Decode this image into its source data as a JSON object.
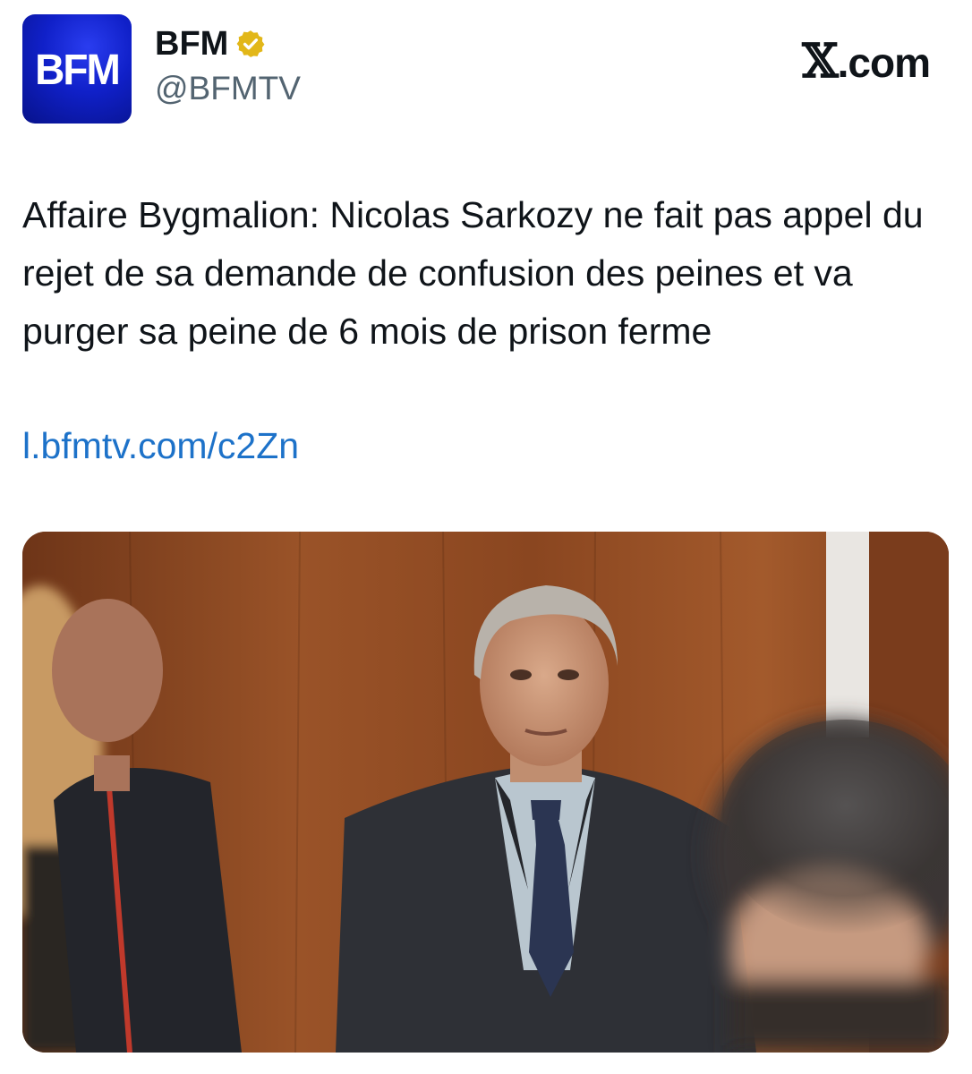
{
  "author": {
    "avatar_text": "BFM",
    "display_name": "BFM",
    "handle": "@BFMTV",
    "verified_icon": "gold-verified-badge-icon"
  },
  "brand": {
    "logo_icon": "x-logo-icon",
    "logo_glyph": "𝕏",
    "domain": ".com"
  },
  "tweet": {
    "text": "Affaire Bygmalion: Nicolas Sarkozy ne fait pas appel du rejet de sa demande de confusion des peines et va purger sa peine de 6 mois de prison ferme",
    "link": "l.bfmtv.com/c2Zn",
    "media": {
      "type": "photo"
    }
  },
  "colors": {
    "avatar_bg": "#1020c8",
    "verified_gold": "#e2b719",
    "link": "#1d72c9",
    "text": "#0f1419",
    "secondary_text": "#536471"
  }
}
